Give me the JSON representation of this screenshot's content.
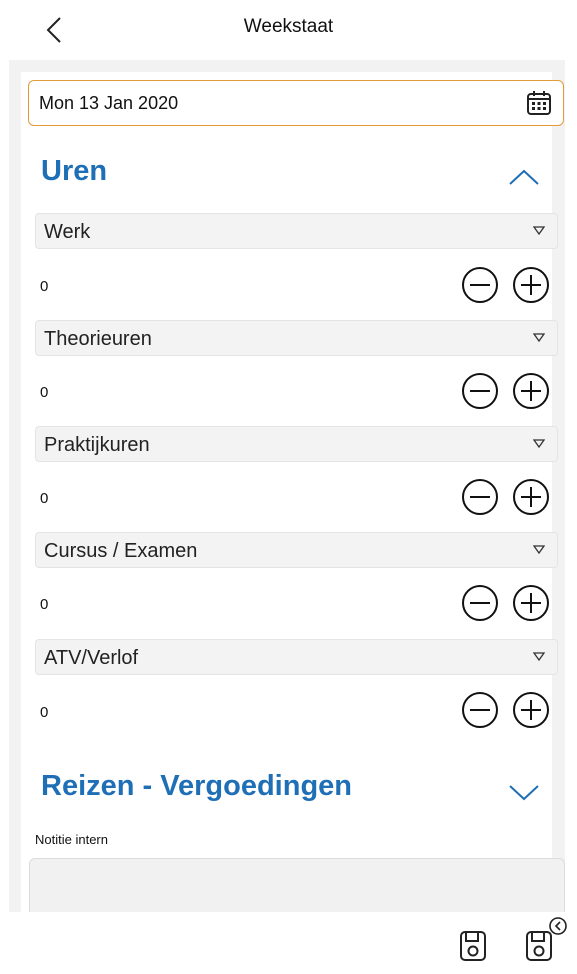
{
  "header": {
    "title": "Weekstaat",
    "back_icon": "chevron-left-icon"
  },
  "date_field": {
    "value": "Mon 13 Jan 2020",
    "icon": "calendar-icon",
    "border_color": "#e29b39"
  },
  "sections": {
    "uren": {
      "title": "Uren",
      "expanded": true
    },
    "reizen": {
      "title": "Reizen - Vergoedingen",
      "expanded": false
    }
  },
  "hour_rows": [
    {
      "type": "Werk",
      "value": "0"
    },
    {
      "type": "Theorieuren",
      "value": "0"
    },
    {
      "type": "Praktijkuren",
      "value": "0"
    },
    {
      "type": "Cursus / Examen",
      "value": "0"
    },
    {
      "type": "ATV/Verlof",
      "value": "0"
    }
  ],
  "note": {
    "label": "Notitie intern",
    "value": ""
  },
  "toolbar": {
    "save_icon": "save-icon",
    "save_close_icon": "save-close-icon"
  },
  "colors": {
    "accent": "#1f6fb6",
    "panel": "#f2f2f3"
  }
}
